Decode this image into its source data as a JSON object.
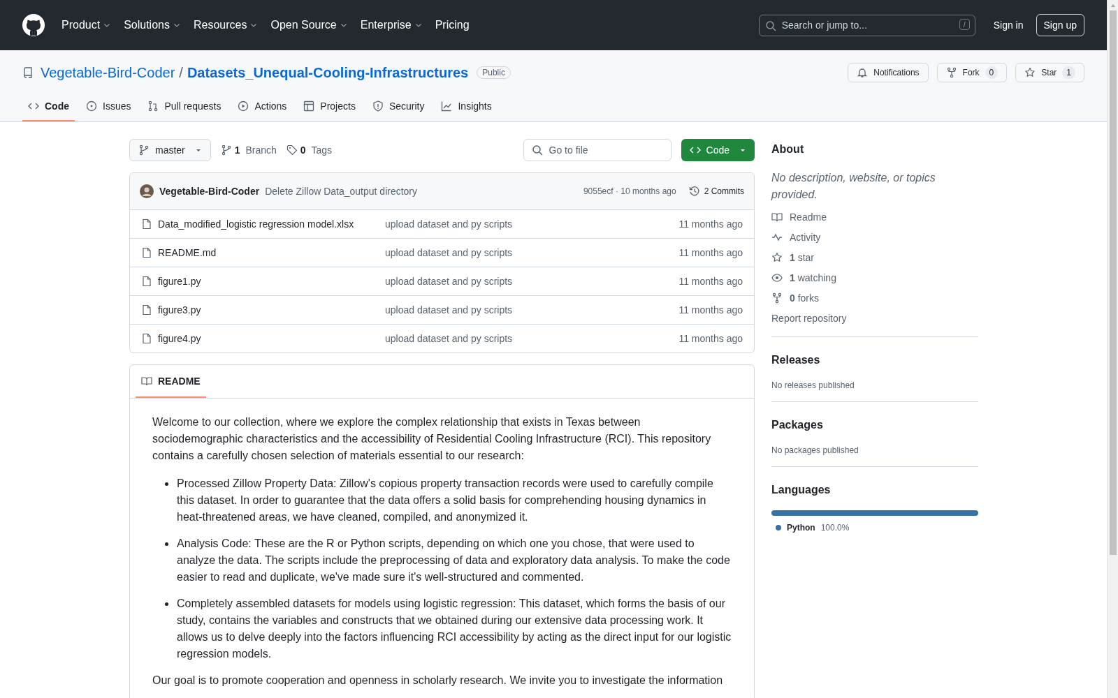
{
  "header": {
    "nav": [
      {
        "label": "Product",
        "dropdown": true
      },
      {
        "label": "Solutions",
        "dropdown": true
      },
      {
        "label": "Resources",
        "dropdown": true
      },
      {
        "label": "Open Source",
        "dropdown": true
      },
      {
        "label": "Enterprise",
        "dropdown": true
      },
      {
        "label": "Pricing",
        "dropdown": false
      }
    ],
    "search": {
      "placeholder": "Search or jump to...",
      "shortcut": "/"
    },
    "sign_in": "Sign in",
    "sign_up": "Sign up"
  },
  "repo": {
    "owner": "Vegetable-Bird-Coder",
    "separator": "/",
    "name": "Datasets_Unequal-Cooling-Infrastructures",
    "visibility": "Public",
    "actions": [
      {
        "kind": "notifications",
        "label": "Notifications"
      },
      {
        "kind": "fork",
        "label": "Fork",
        "count": "0"
      },
      {
        "kind": "star",
        "label": "Star",
        "count": "1"
      }
    ]
  },
  "tabs": [
    {
      "kind": "code",
      "label": "Code",
      "selected": true
    },
    {
      "kind": "issues",
      "label": "Issues",
      "selected": false
    },
    {
      "kind": "pulls",
      "label": "Pull requests",
      "selected": false
    },
    {
      "kind": "actions",
      "label": "Actions",
      "selected": false
    },
    {
      "kind": "projects",
      "label": "Projects",
      "selected": false
    },
    {
      "kind": "security",
      "label": "Security",
      "selected": false
    },
    {
      "kind": "insights",
      "label": "Insights",
      "selected": false
    }
  ],
  "toolbar": {
    "branch": "master",
    "branches": {
      "count": "1",
      "label": "Branch"
    },
    "tags": {
      "count": "0",
      "label": "Tags"
    },
    "go_to_file": {
      "placeholder": "Go to file"
    },
    "code_button": "Code"
  },
  "latest_commit": {
    "author": "Vegetable-Bird-Coder",
    "message": "Delete Zillow Data_output directory",
    "hash_time": "9055ecf · 10 months ago",
    "commits": "2 Commits"
  },
  "files": [
    {
      "name": "Data_modified_logistic regression model.xlsx",
      "message": "upload dataset and py scripts",
      "time": "11 months ago"
    },
    {
      "name": "README.md",
      "message": "upload dataset and py scripts",
      "time": "11 months ago"
    },
    {
      "name": "figure1.py",
      "message": "upload dataset and py scripts",
      "time": "11 months ago"
    },
    {
      "name": "figure3.py",
      "message": "upload dataset and py scripts",
      "time": "11 months ago"
    },
    {
      "name": "figure4.py",
      "message": "upload dataset and py scripts",
      "time": "11 months ago"
    }
  ],
  "readme": {
    "tab": "README",
    "intro": "Welcome to our collection, where we explore the complex relationship that exists in Texas between sociodemographic characteristics and the accessibility of Residential Cooling Infrastructure (RCI). This repository contains a carefully chosen selection of materials essential to our research:",
    "bullets": [
      "Processed Zillow Property Data: Zillow's copious property transaction records were used to carefully compile this dataset. In order to guarantee that the data offers a solid basis for comprehending housing dynamics in heat-threatened areas, we have cleaned, compiled, and anonymized it.",
      "Analysis Code: These are the R or Python scripts, depending on which one you chose, that were used to analyze the data. The scripts include the preprocessing of data and exploratory data analysis. To make the code easier to read and duplicate, we've made sure it's well-structured and commented.",
      "Completely assembled datasets for models using logistic regression: This dataset, which forms the basis of our study, contains the variables and constructs that we obtained during our extensive data processing work. It allows us to delve deeply into the factors influencing RCI accessibility by acting as the direct input for our logistic regression models."
    ],
    "outro": "Our goal is to promote cooperation and openness in scholarly research. We invite you to investigate the information"
  },
  "sidebar": {
    "about": {
      "heading": "About",
      "description": "No description, website, or topics provided.",
      "links": [
        {
          "kind": "readme",
          "label": "Readme"
        },
        {
          "kind": "activity",
          "label": "Activity"
        },
        {
          "kind": "star",
          "count": "1",
          "label": "star"
        },
        {
          "kind": "watch",
          "count": "1",
          "label": "watching"
        },
        {
          "kind": "fork",
          "count": "0",
          "label": "forks"
        }
      ],
      "report": "Report repository"
    },
    "sections": [
      {
        "heading": "Releases",
        "note": "No releases published"
      },
      {
        "heading": "Packages",
        "note": "No packages published"
      }
    ],
    "languages": {
      "heading": "Languages",
      "items": [
        {
          "name": "Python",
          "percent": "100.0%",
          "color": "#3572a5",
          "level": 1.0
        }
      ]
    }
  }
}
